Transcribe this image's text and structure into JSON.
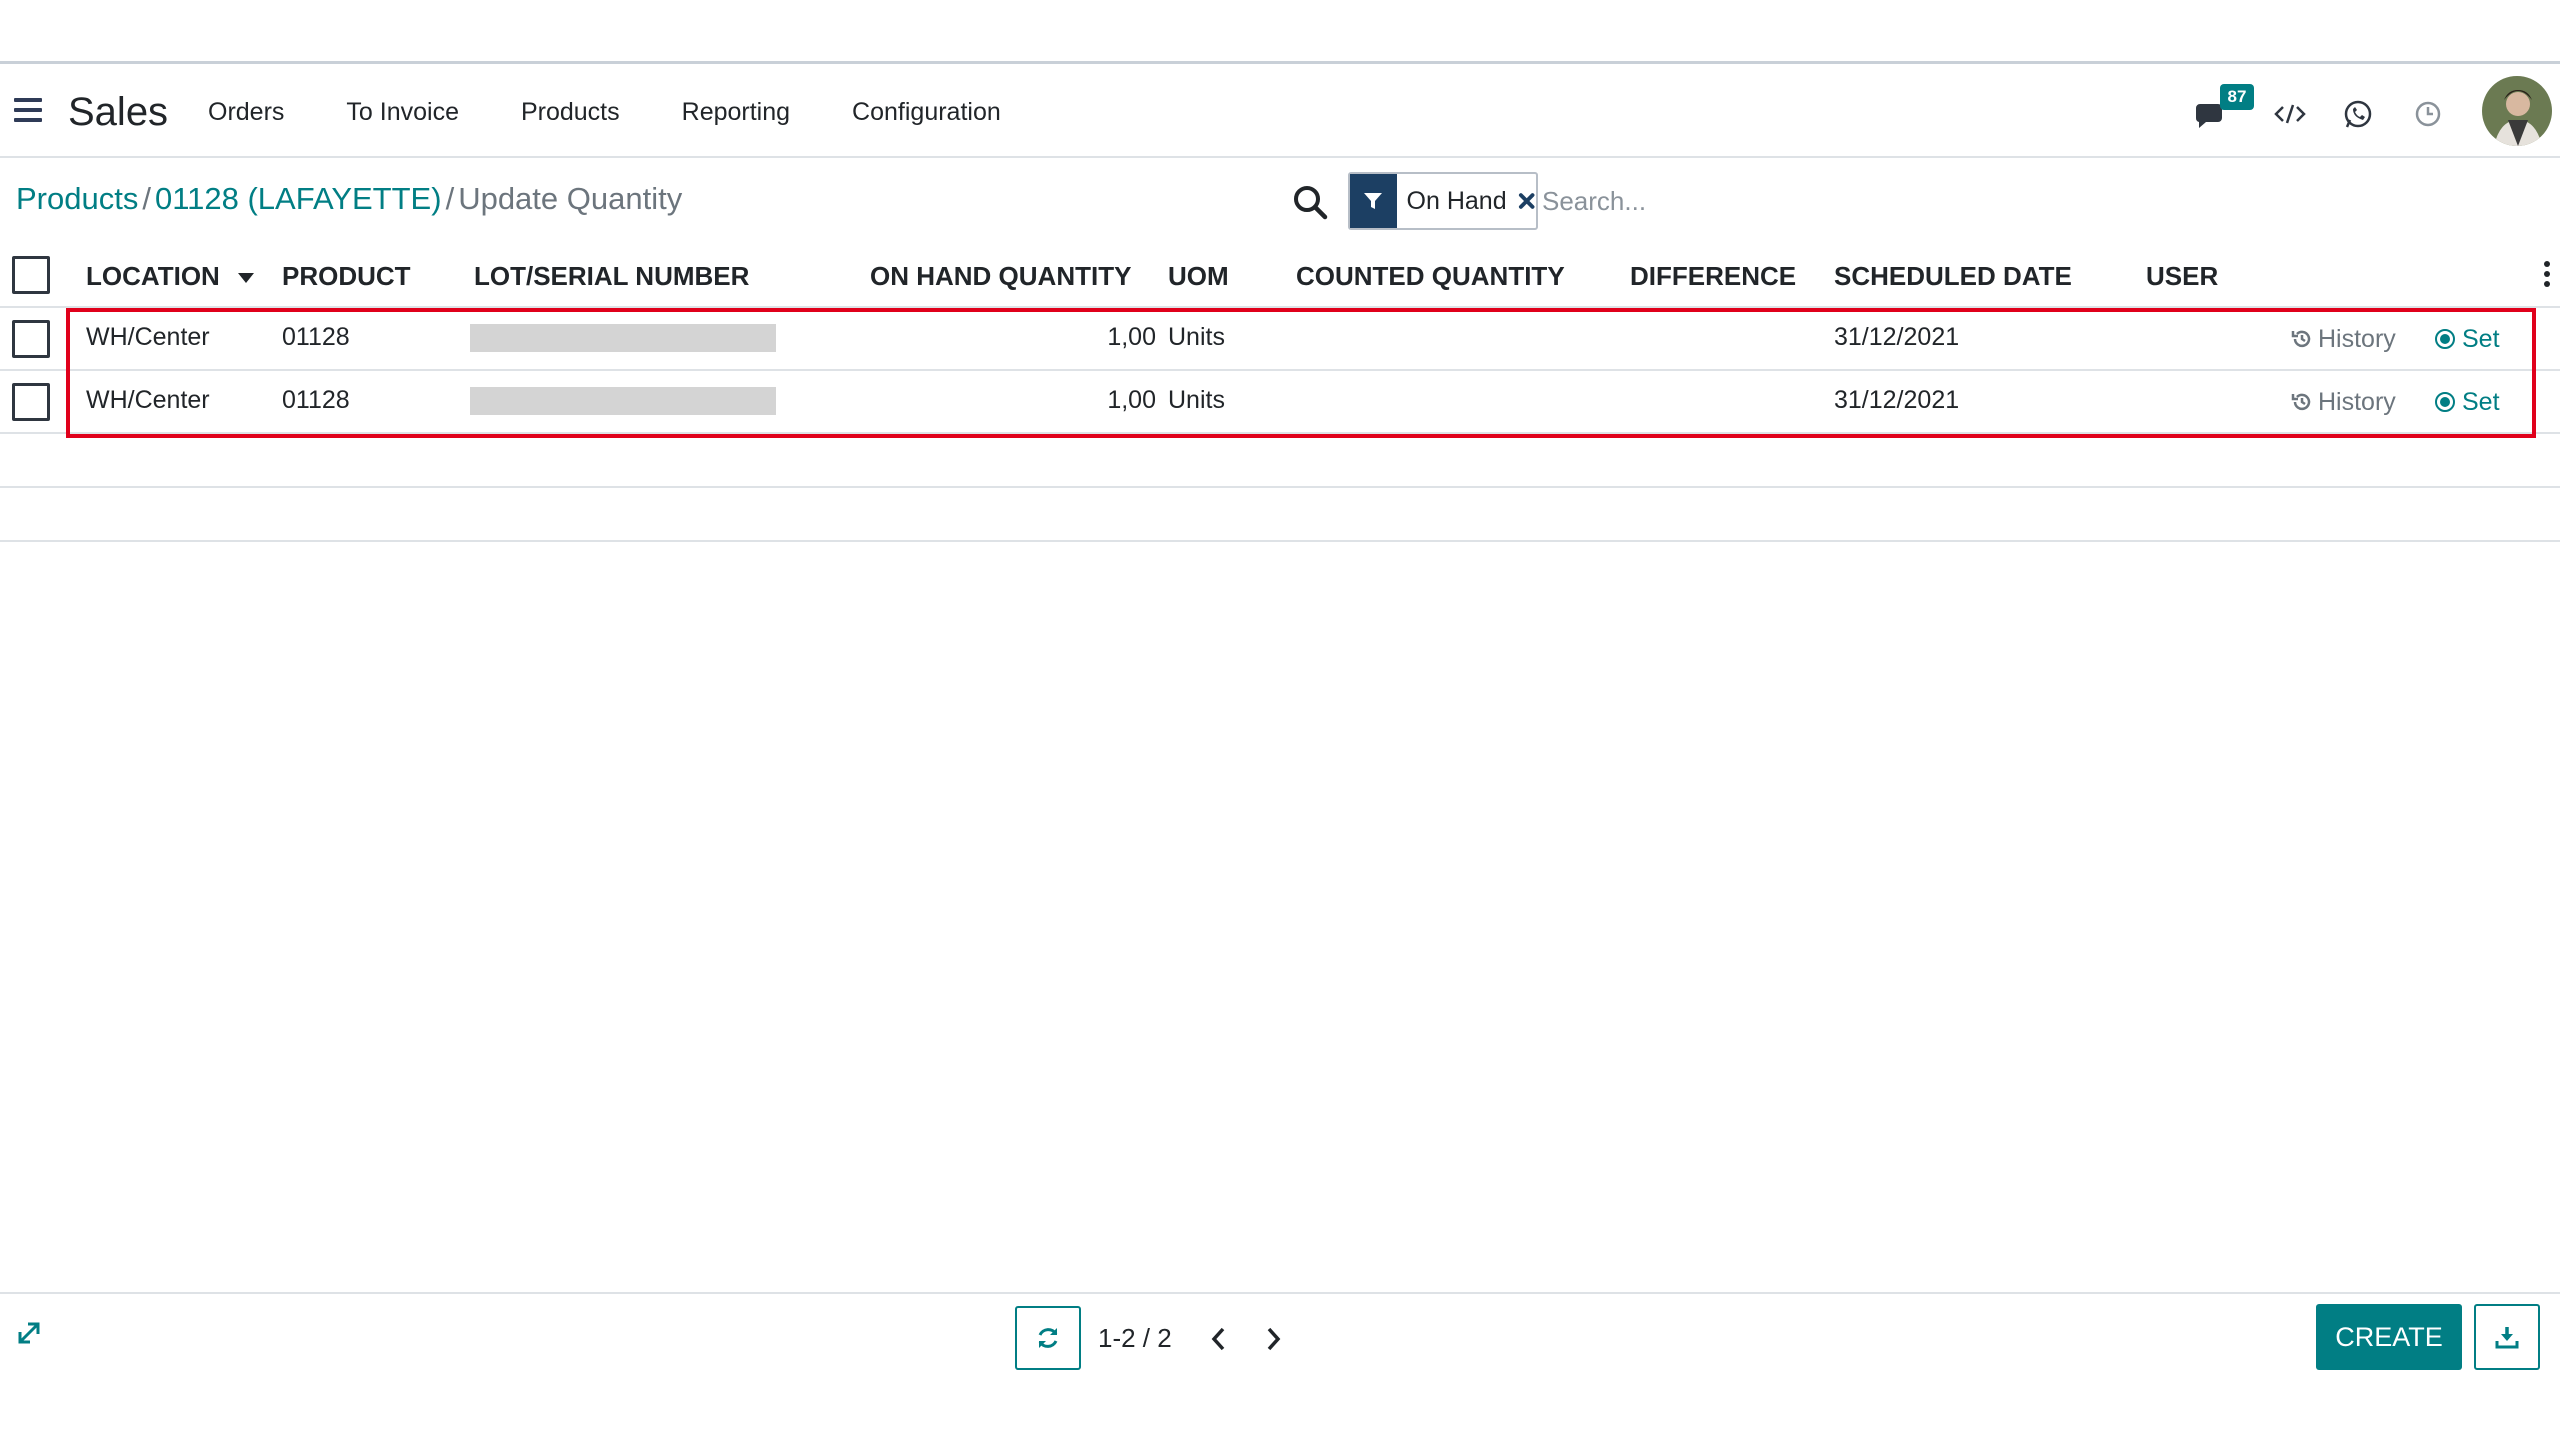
{
  "navbar": {
    "app_name": "Sales",
    "menu": [
      "Orders",
      "To Invoice",
      "Products",
      "Reporting",
      "Configuration"
    ],
    "messages_count": "87",
    "icons": [
      "chat-icon",
      "code-icon",
      "whatsapp-icon",
      "clock-icon"
    ]
  },
  "breadcrumb": {
    "items": [
      "Products",
      "01128 (LAFAYETTE)"
    ],
    "separator": "/",
    "active": "Update Quantity"
  },
  "search": {
    "facet_label": "On Hand",
    "placeholder": "Search..."
  },
  "table": {
    "columns": [
      "LOCATION",
      "PRODUCT",
      "LOT/SERIAL NUMBER",
      "ON HAND QUANTITY",
      "UOM",
      "COUNTED QUANTITY",
      "DIFFERENCE",
      "SCHEDULED DATE",
      "USER"
    ],
    "rows": [
      {
        "location": "WH/Center",
        "product": "01128",
        "lot": "",
        "on_hand": "1,00",
        "uom": "Units",
        "counted": "",
        "difference": "",
        "scheduled_date": "31/12/2021",
        "user": "",
        "history_label": "History",
        "set_label": "Set"
      },
      {
        "location": "WH/Center",
        "product": "01128",
        "lot": "",
        "on_hand": "1,00",
        "uom": "Units",
        "counted": "",
        "difference": "",
        "scheduled_date": "31/12/2021",
        "user": "",
        "history_label": "History",
        "set_label": "Set"
      }
    ]
  },
  "footer": {
    "pager": "1-2 / 2",
    "create_label": "CREATE"
  },
  "colors": {
    "accent": "#017e84",
    "facet_bg": "#1c3f63",
    "highlight": "#e0001b"
  }
}
